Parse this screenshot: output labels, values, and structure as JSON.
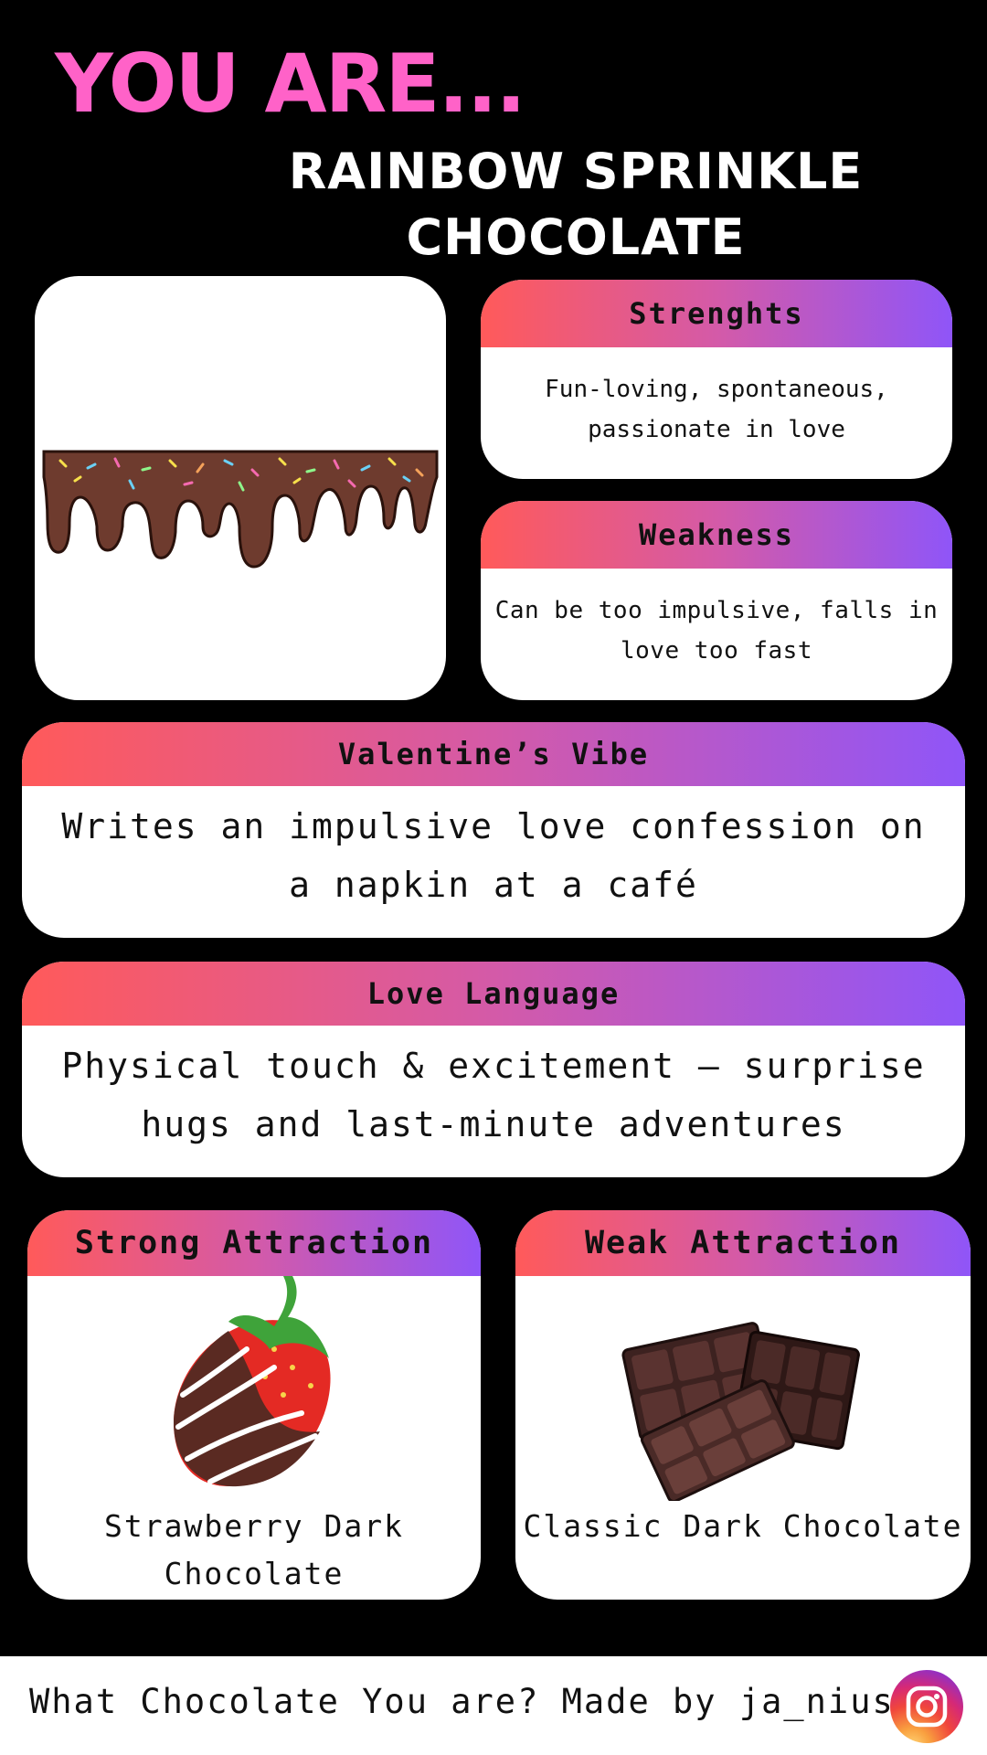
{
  "header": {
    "you_are": "YOU ARE...",
    "title_line1": "RAINBOW SPRINKLE",
    "title_line2": "CHOCOLATE"
  },
  "strengths": {
    "title": "Strenghts",
    "text": "Fun-loving, spontaneous, passionate in love"
  },
  "weakness": {
    "title": "Weakness",
    "text": "Can be too impulsive, falls in love too fast"
  },
  "valentines_vibe": {
    "title": "Valentine’s Vibe",
    "text": "Writes an impulsive love confession on a napkin at a café"
  },
  "love_language": {
    "title": "Love Language",
    "text": "Physical touch & excitement – surprise hugs and last-minute adventures"
  },
  "strong_attraction": {
    "title": "Strong Attraction",
    "name": "Strawberry Dark Chocolate"
  },
  "weak_attraction": {
    "title": "Weak Attraction",
    "name": "Classic Dark Chocolate"
  },
  "footer": {
    "text": "What Chocolate You are?  Made by ja_niusx",
    "icon": "instagram-icon"
  },
  "colors": {
    "accent_pink": "#ff62c8",
    "gradient_start": "#ff5a5a",
    "gradient_end": "#8f55f8",
    "background": "#000000"
  }
}
